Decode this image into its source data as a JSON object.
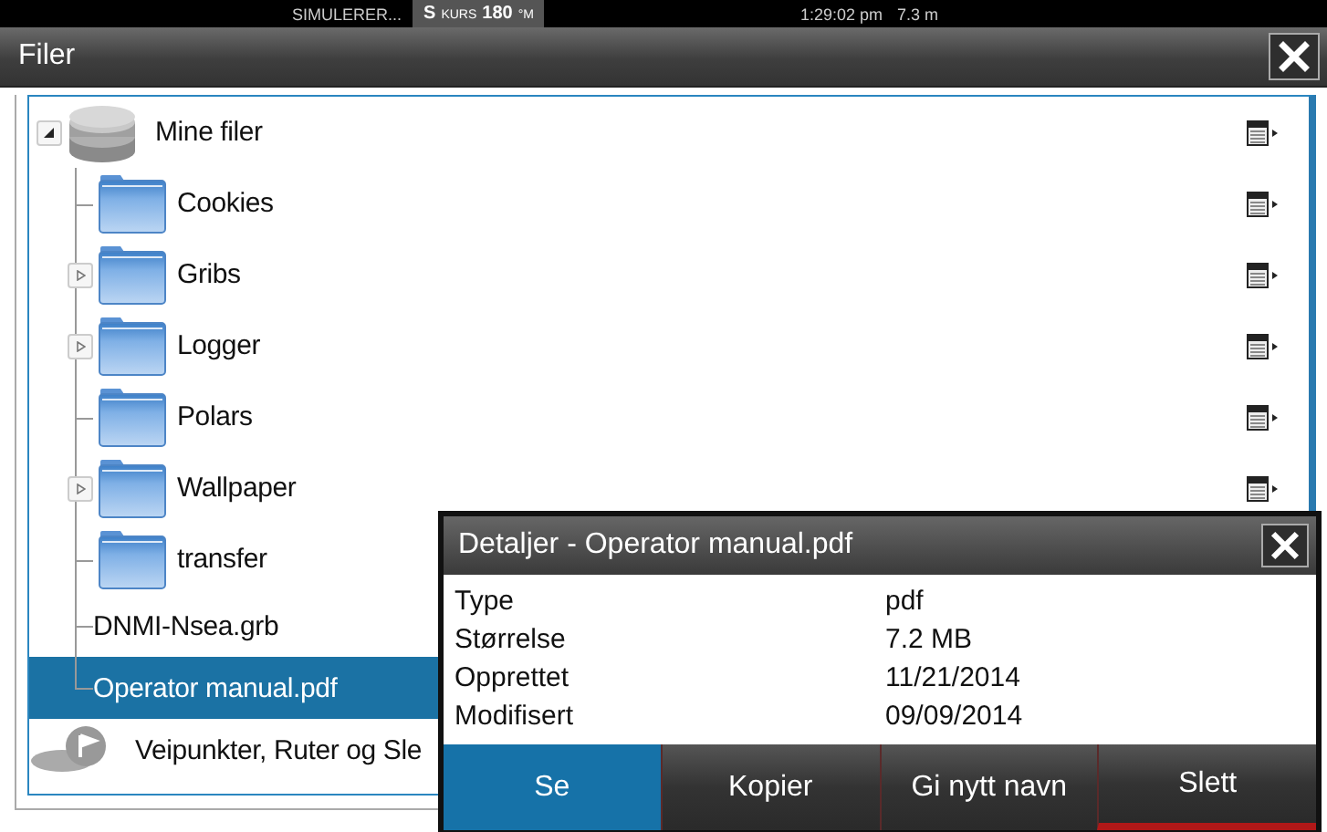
{
  "status_bar": {
    "mode": "SIMULERER...",
    "heading_prefix": "S",
    "heading_label": "KURS",
    "heading_value": "180",
    "heading_unit": "°M",
    "time": "1:29:02 pm",
    "depth": "7.3 m"
  },
  "window": {
    "title": "Filer"
  },
  "tree": [
    {
      "label": "Mine filer",
      "kind": "drive",
      "has_children": true,
      "expanded": true,
      "selected": false,
      "menu": true,
      "children": [
        {
          "label": "Cookies",
          "kind": "folder",
          "has_children": false,
          "selected": false,
          "menu": true
        },
        {
          "label": "Gribs",
          "kind": "folder",
          "has_children": true,
          "expanded": false,
          "selected": false,
          "menu": true
        },
        {
          "label": "Logger",
          "kind": "folder",
          "has_children": true,
          "expanded": false,
          "selected": false,
          "menu": true
        },
        {
          "label": "Polars",
          "kind": "folder",
          "has_children": false,
          "selected": false,
          "menu": true
        },
        {
          "label": "Wallpaper",
          "kind": "folder",
          "has_children": true,
          "expanded": false,
          "selected": false,
          "menu": true
        },
        {
          "label": "transfer",
          "kind": "folder",
          "has_children": false,
          "selected": false,
          "menu": false
        },
        {
          "label": "DNMI-Nsea.grb",
          "kind": "file",
          "has_children": false,
          "selected": false,
          "menu": false
        },
        {
          "label": "Operator manual.pdf",
          "kind": "file",
          "has_children": false,
          "selected": true,
          "menu": false
        }
      ]
    },
    {
      "label": "Veipunkter, Ruter og Sle",
      "kind": "waypoints",
      "has_children": false,
      "selected": false,
      "menu": false
    }
  ],
  "dialog": {
    "title": "Detaljer - Operator manual.pdf",
    "rows": [
      {
        "label": "Type",
        "value": "pdf"
      },
      {
        "label": "Størrelse",
        "value": "7.2 MB"
      },
      {
        "label": "Opprettet",
        "value": "11/21/2014"
      },
      {
        "label": "Modifisert",
        "value": "09/09/2014"
      }
    ],
    "buttons": [
      {
        "label": "Se",
        "kind": "normal",
        "selected": true
      },
      {
        "label": "Kopier",
        "kind": "normal",
        "selected": false
      },
      {
        "label": "Gi nytt navn",
        "kind": "normal",
        "selected": false
      },
      {
        "label": "Slett",
        "kind": "danger",
        "selected": false
      }
    ]
  }
}
